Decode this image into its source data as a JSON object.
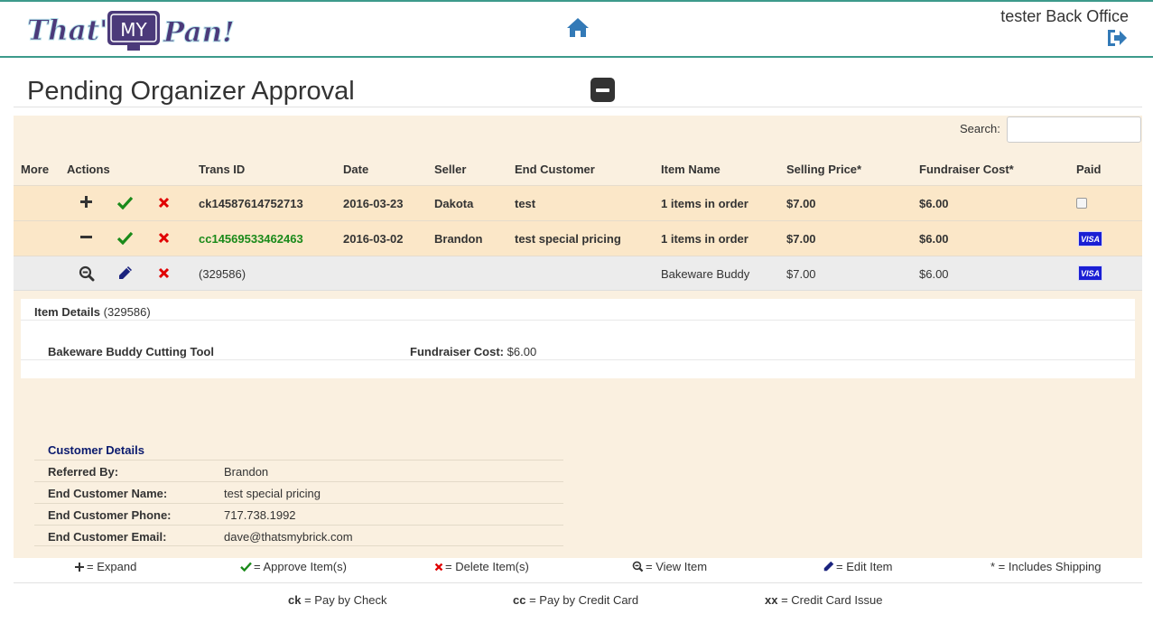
{
  "header": {
    "logo_text_1": "That's",
    "logo_text_2": "MY",
    "logo_text_3": "Pan!",
    "user_label": "tester Back Office"
  },
  "page": {
    "title": "Pending Organizer Approval"
  },
  "search": {
    "label": "Search:",
    "value": "",
    "placeholder": ""
  },
  "table": {
    "columns": [
      "More",
      "Actions",
      "Trans ID",
      "Date",
      "Seller",
      "End Customer",
      "Item Name",
      "Selling Price*",
      "Fundraiser Cost*",
      "Paid"
    ],
    "rows": [
      {
        "trans_id": "ck14587614752713",
        "date": "2016-03-23",
        "seller": "Dakota",
        "end_customer": "test",
        "item_name": "1 items in order",
        "selling_price": "$7.00",
        "fundraiser_cost": "$6.00",
        "paid": "checkbox"
      },
      {
        "trans_id": "cc14569533462463",
        "date": "2016-03-02",
        "seller": "Brandon",
        "end_customer": "test special pricing",
        "item_name": "1 items in order",
        "selling_price": "$7.00",
        "fundraiser_cost": "$6.00",
        "paid": "VISA"
      }
    ],
    "sub_row": {
      "trans_id": "(329586)",
      "item_name": "Bakeware Buddy",
      "selling_price": "$7.00",
      "fundraiser_cost": "$6.00",
      "paid": "VISA"
    }
  },
  "item_details": {
    "label": "Item Details",
    "id": "(329586)",
    "product_name": "Bakeware Buddy Cutting Tool",
    "fundraiser_cost_label": "Fundraiser Cost:",
    "fundraiser_cost_value": "$6.00"
  },
  "customer_details": {
    "title": "Customer Details",
    "rows": [
      {
        "label": "Referred By:",
        "value": "Brandon"
      },
      {
        "label": "End Customer Name:",
        "value": "test special pricing"
      },
      {
        "label": "End Customer Phone:",
        "value": "717.738.1992"
      },
      {
        "label": "End Customer Email:",
        "value": "dave@thatsmybrick.com"
      }
    ]
  },
  "legend": {
    "expand": "= Expand",
    "approve": "= Approve Item(s)",
    "delete": "= Delete Item(s)",
    "view": "= View Item",
    "edit": "= Edit Item",
    "shipping": "* = Includes Shipping",
    "ck_code": "ck",
    "ck_text": "= Pay by Check",
    "cc_code": "cc",
    "cc_text": "= Pay by Credit Card",
    "xx_code": "xx",
    "xx_text": "= Credit Card Issue"
  },
  "colors": {
    "accent": "#3d9a8b",
    "panel_bg": "#faf0e0",
    "row_bg": "#fbe7c8",
    "approve_green": "#1a8a1a",
    "delete_red": "#e00000",
    "brand_purple": "#4b3a7a",
    "visa_blue": "#1a1fd4",
    "link_blue": "#337ab7"
  },
  "icons": {
    "home": "home-icon",
    "logout": "sign-out-icon",
    "expand": "plus-icon",
    "collapse": "minus-icon",
    "approve": "checkmark-icon",
    "delete": "x-icon",
    "view": "zoom-out-icon",
    "edit": "pencil-icon"
  }
}
